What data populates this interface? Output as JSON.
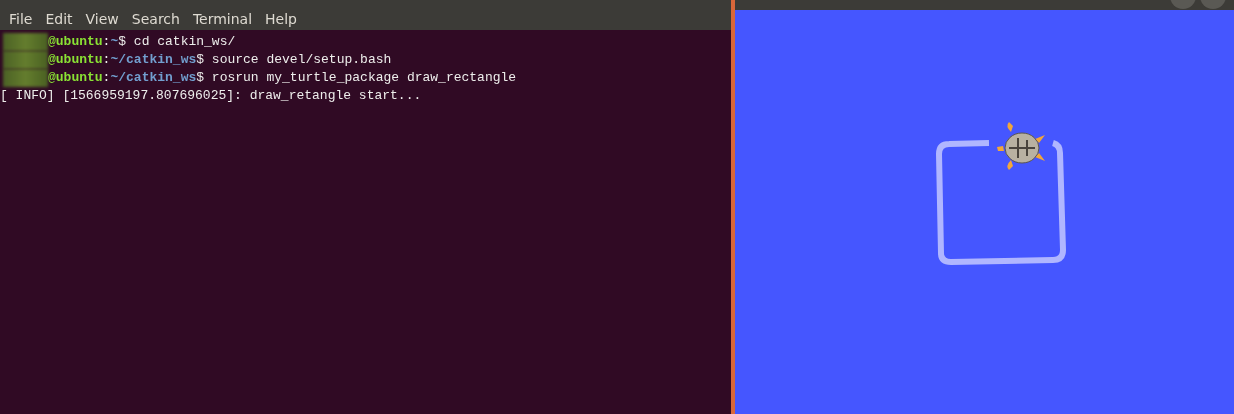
{
  "terminal": {
    "menu": [
      "File",
      "Edit",
      "View",
      "Search",
      "Terminal",
      "Help"
    ],
    "lines": [
      {
        "kind": "prompt",
        "host": "@ubuntu",
        "sep": ":",
        "path": "~",
        "command": "$ cd catkin_ws/"
      },
      {
        "kind": "prompt",
        "host": "@ubuntu",
        "sep": ":",
        "path": "~/catkin_ws",
        "command": "$ source devel/setup.bash"
      },
      {
        "kind": "prompt",
        "host": "@ubuntu",
        "sep": ":",
        "path": "~/catkin_ws",
        "command": "$ rosrun my_turtle_package draw_rectangle"
      },
      {
        "kind": "output",
        "text": "[ INFO] [1566959197.807696025]: draw_retangle start..."
      }
    ]
  }
}
